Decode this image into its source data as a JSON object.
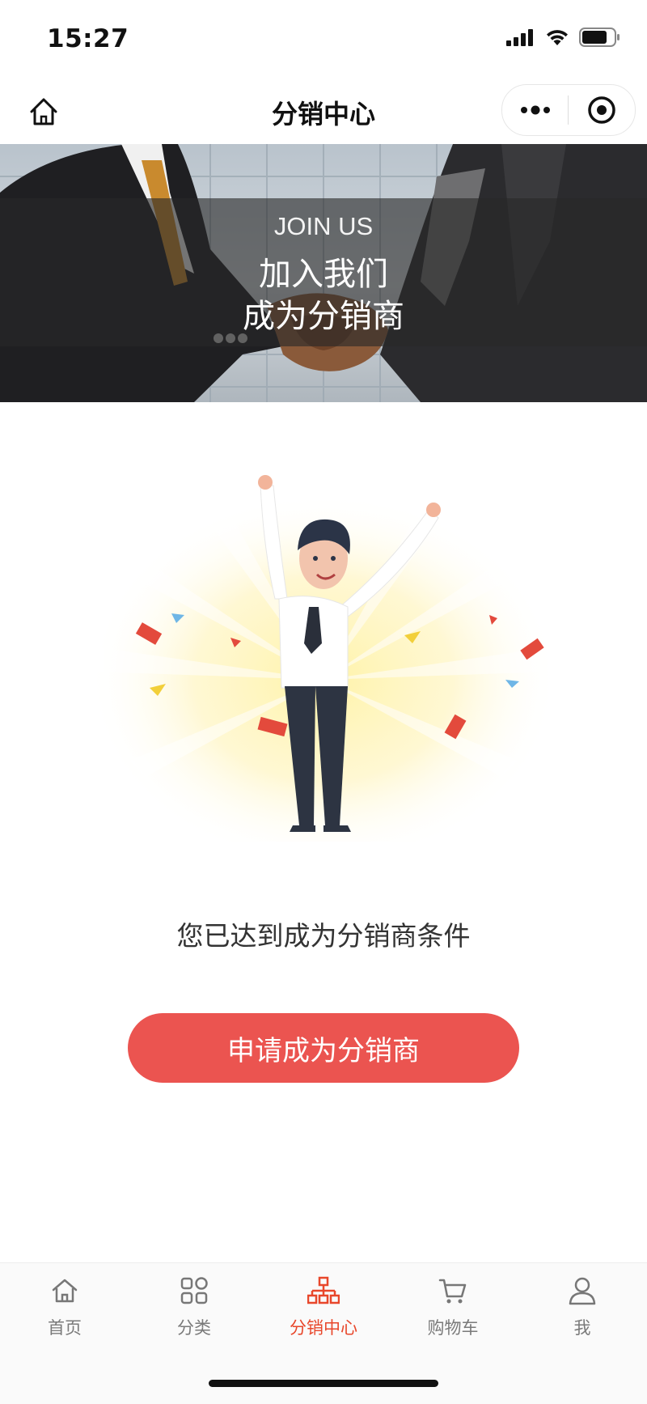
{
  "status_bar": {
    "time": "15:27",
    "icons": [
      "cellular-signal-icon",
      "wifi-icon",
      "battery-icon"
    ]
  },
  "nav": {
    "title": "分销中心",
    "icons": [
      "home-icon",
      "more-dots-icon",
      "close-target-icon"
    ]
  },
  "banner": {
    "en": "JOIN US",
    "line1": "加入我们",
    "line2": "成为分销商"
  },
  "main": {
    "condition_text": "您已达到成为分销商条件",
    "apply_button": "申请成为分销商"
  },
  "tabbar": {
    "items": [
      {
        "label": "首页",
        "icon": "home-icon",
        "active": false
      },
      {
        "label": "分类",
        "icon": "category-grid-icon",
        "active": false
      },
      {
        "label": "分销中心",
        "icon": "distribution-tree-icon",
        "active": true
      },
      {
        "label": "购物车",
        "icon": "cart-icon",
        "active": false
      },
      {
        "label": "我",
        "icon": "user-icon",
        "active": false
      }
    ]
  },
  "colors": {
    "accent": "#eb5450",
    "tab_active": "#e8472b",
    "tab_inactive": "#7a7a7a"
  }
}
